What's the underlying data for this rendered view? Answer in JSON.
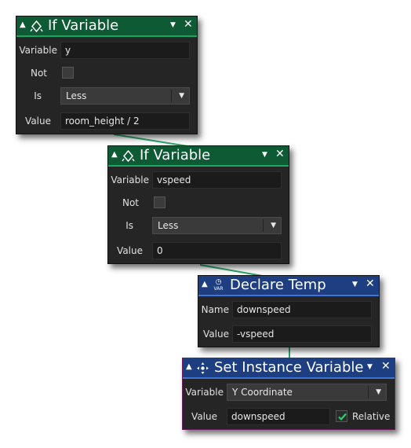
{
  "blocks": [
    {
      "title": "If Variable",
      "icon": "if-variable-icon",
      "header_color": "#0d5a34",
      "fields": {
        "variable_label": "Variable",
        "variable_value": "y",
        "not_label": "Not",
        "not_checked": false,
        "is_label": "Is",
        "is_value": "Less",
        "value_label": "Value",
        "value_value": "room_height / 2"
      }
    },
    {
      "title": "If Variable",
      "icon": "if-variable-icon",
      "header_color": "#0d5a34",
      "fields": {
        "variable_label": "Variable",
        "variable_value": "vspeed",
        "not_label": "Not",
        "not_checked": false,
        "is_label": "Is",
        "is_value": "Less",
        "value_label": "Value",
        "value_value": "0"
      }
    },
    {
      "title": "Declare Temp",
      "icon": "declare-temp-var-icon",
      "icon_text": "VAR",
      "header_color": "#1d3f82",
      "fields": {
        "name_label": "Name",
        "name_value": "downspeed",
        "value_label": "Value",
        "value_value": "-vspeed"
      }
    },
    {
      "title": "Set Instance Variable",
      "icon": "set-instance-variable-icon",
      "header_color": "#1d3f82",
      "fields": {
        "variable_label": "Variable",
        "variable_value": "Y Coordinate",
        "value_label": "Value",
        "value_value": "downspeed",
        "relative_label": "Relative",
        "relative_checked": true
      }
    }
  ],
  "icons": {
    "collapse": "▲",
    "dropdown": "▼",
    "close": "✕"
  },
  "colors": {
    "green_header": "#0d5a34",
    "blue_header": "#1d3f82",
    "connector": "#2ca86e",
    "checkmark": "#2ecc71"
  }
}
